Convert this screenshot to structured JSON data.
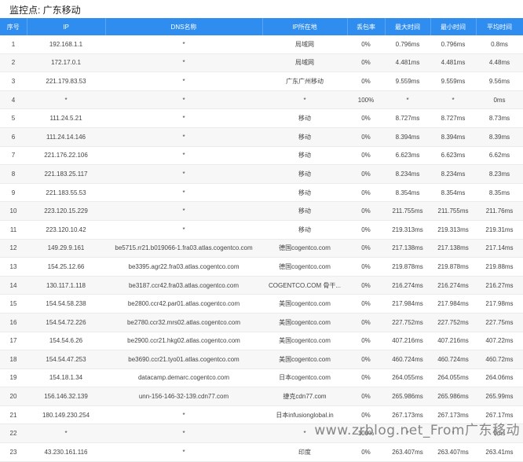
{
  "header": {
    "title": "监控点: 广东移动"
  },
  "table": {
    "columns": [
      "序号",
      "IP",
      "DNS名称",
      "IP所在地",
      "丢包率",
      "最大时间",
      "最小时间",
      "平均时间"
    ],
    "rows": [
      [
        "1",
        "192.168.1.1",
        "*",
        "局域网",
        "0%",
        "0.796ms",
        "0.796ms",
        "0.8ms"
      ],
      [
        "2",
        "172.17.0.1",
        "*",
        "局域网",
        "0%",
        "4.481ms",
        "4.481ms",
        "4.48ms"
      ],
      [
        "3",
        "221.179.83.53",
        "*",
        "广东广州移动",
        "0%",
        "9.559ms",
        "9.559ms",
        "9.56ms"
      ],
      [
        "4",
        "*",
        "*",
        "*",
        "100%",
        "*",
        "*",
        "0ms"
      ],
      [
        "5",
        "111.24.5.21",
        "*",
        "移动",
        "0%",
        "8.727ms",
        "8.727ms",
        "8.73ms"
      ],
      [
        "6",
        "111.24.14.146",
        "*",
        "移动",
        "0%",
        "8.394ms",
        "8.394ms",
        "8.39ms"
      ],
      [
        "7",
        "221.176.22.106",
        "*",
        "移动",
        "0%",
        "6.623ms",
        "6.623ms",
        "6.62ms"
      ],
      [
        "8",
        "221.183.25.117",
        "*",
        "移动",
        "0%",
        "8.234ms",
        "8.234ms",
        "8.23ms"
      ],
      [
        "9",
        "221.183.55.53",
        "*",
        "移动",
        "0%",
        "8.354ms",
        "8.354ms",
        "8.35ms"
      ],
      [
        "10",
        "223.120.15.229",
        "*",
        "移动",
        "0%",
        "211.755ms",
        "211.755ms",
        "211.76ms"
      ],
      [
        "11",
        "223.120.10.42",
        "*",
        "移动",
        "0%",
        "219.313ms",
        "219.313ms",
        "219.31ms"
      ],
      [
        "12",
        "149.29.9.161",
        "be5715.rr21.b019066-1.fra03.atlas.cogentco.com",
        "德国cogentco.com",
        "0%",
        "217.138ms",
        "217.138ms",
        "217.14ms"
      ],
      [
        "13",
        "154.25.12.66",
        "be3395.agr22.fra03.atlas.cogentco.com",
        "德国cogentco.com",
        "0%",
        "219.878ms",
        "219.878ms",
        "219.88ms"
      ],
      [
        "14",
        "130.117.1.118",
        "be3187.ccr42.fra03.atlas.cogentco.com",
        "COGENTCO.COM 骨干...",
        "0%",
        "216.274ms",
        "216.274ms",
        "216.27ms"
      ],
      [
        "15",
        "154.54.58.238",
        "be2800.ccr42.par01.atlas.cogentco.com",
        "美国cogentco.com",
        "0%",
        "217.984ms",
        "217.984ms",
        "217.98ms"
      ],
      [
        "16",
        "154.54.72.226",
        "be2780.ccr32.mrs02.atlas.cogentco.com",
        "美国cogentco.com",
        "0%",
        "227.752ms",
        "227.752ms",
        "227.75ms"
      ],
      [
        "17",
        "154.54.6.26",
        "be2900.ccr21.hkg02.atlas.cogentco.com",
        "美国cogentco.com",
        "0%",
        "407.216ms",
        "407.216ms",
        "407.22ms"
      ],
      [
        "18",
        "154.54.47.253",
        "be3690.ccr21.tyo01.atlas.cogentco.com",
        "美国cogentco.com",
        "0%",
        "460.724ms",
        "460.724ms",
        "460.72ms"
      ],
      [
        "19",
        "154.18.1.34",
        "datacamp.demarc.cogentco.com",
        "日本cogentco.com",
        "0%",
        "264.055ms",
        "264.055ms",
        "264.06ms"
      ],
      [
        "20",
        "156.146.32.139",
        "unn-156-146-32-139.cdn77.com",
        "捷克cdn77.com",
        "0%",
        "265.986ms",
        "265.986ms",
        "265.99ms"
      ],
      [
        "21",
        "180.149.230.254",
        "*",
        "日本infusionglobal.in",
        "0%",
        "267.173ms",
        "267.173ms",
        "267.17ms"
      ],
      [
        "22",
        "*",
        "*",
        "*",
        "100%",
        "*",
        "*",
        "0ms"
      ],
      [
        "23",
        "43.230.161.116",
        "*",
        "印度",
        "0%",
        "263.407ms",
        "263.407ms",
        "263.41ms"
      ]
    ]
  },
  "watermark": "www.zrblog.net_From广东移动"
}
